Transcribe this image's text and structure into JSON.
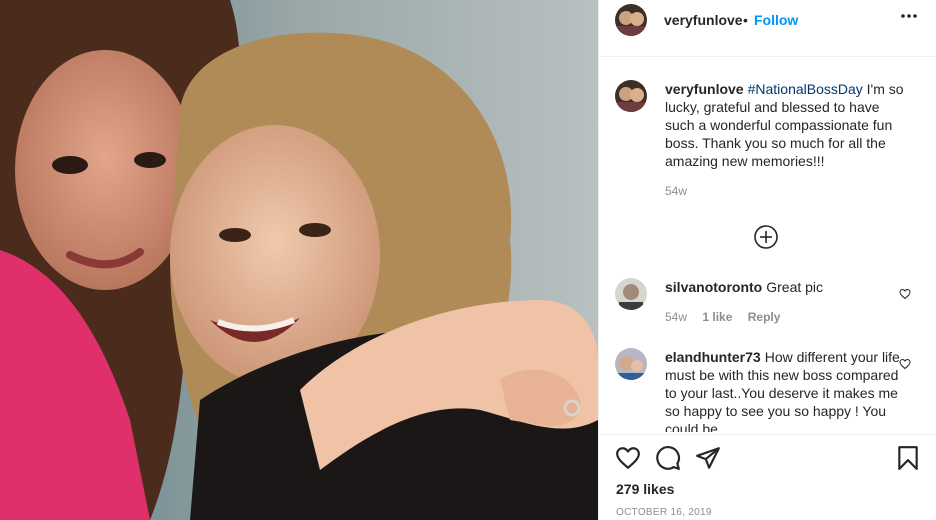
{
  "post": {
    "image_description_alt": "",
    "author": "veryfunlove",
    "follow_label": "Follow",
    "separator": "•"
  },
  "caption": {
    "username": "veryfunlove",
    "hashtag": "#NationalBossDay",
    "text": " I'm so lucky, grateful and blessed to have such a wonderful compassionate fun boss. Thank you so much for all the amazing new memories!!!",
    "time": "54w"
  },
  "comments": [
    {
      "username": "silvanotoronto",
      "text": "Great pic",
      "time": "54w",
      "likes": "1 like",
      "reply": "Reply"
    },
    {
      "username": "elandhunter73",
      "text": "How different your life must be with this new boss compared to your last..You deserve it makes me so happy to see you so happy ! You could be"
    }
  ],
  "actions": {
    "like_icon": "heart-icon",
    "comment_icon": "comment-icon",
    "share_icon": "paper-plane-icon",
    "save_icon": "bookmark-icon"
  },
  "likes_label": "279 likes",
  "date_label": "OCTOBER 16, 2019",
  "colors": {
    "link_blue": "#0095f6",
    "hashtag": "#00376b",
    "muted": "#8e8e8e",
    "text": "#262626"
  }
}
